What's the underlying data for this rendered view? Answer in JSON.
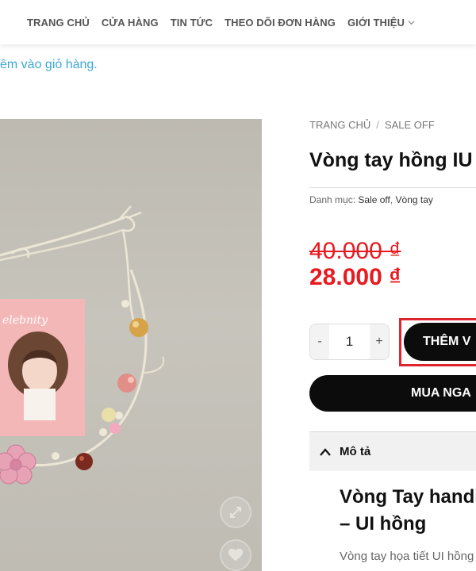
{
  "nav": {
    "items": [
      "TRANG CHỦ",
      "CỬA HÀNG",
      "TIN TỨC",
      "THEO DÕI ĐƠN HÀNG",
      "GIỚI THIỆU"
    ]
  },
  "notice": "êm vào giỏ hàng.",
  "image": {
    "card_text": "elebnity"
  },
  "breadcrumb": {
    "home": "TRANG CHỦ",
    "separator": "/",
    "current": "SALE OFF"
  },
  "product": {
    "title": "Vòng tay hồng IU",
    "category_label": "Danh mục:",
    "categories": [
      "Sale off",
      "Vòng tay"
    ],
    "old_price": "40.000 ₫",
    "new_price": "28.000 ₫",
    "quantity": "1"
  },
  "buttons": {
    "minus": "-",
    "plus": "+",
    "add_to_cart": "THÊM V",
    "buy_now": "MUA NGA"
  },
  "description": {
    "tab_label": "Mô tả",
    "heading_line1": "Vòng Tay handi",
    "heading_line2": "– UI hồng",
    "text": "Vòng tay họa tiết UI hồng"
  },
  "colors": {
    "price": "#e8191f",
    "notice": "#3ba7d6",
    "button": "#0c0c0c",
    "highlight_frame": "#e0242e"
  }
}
